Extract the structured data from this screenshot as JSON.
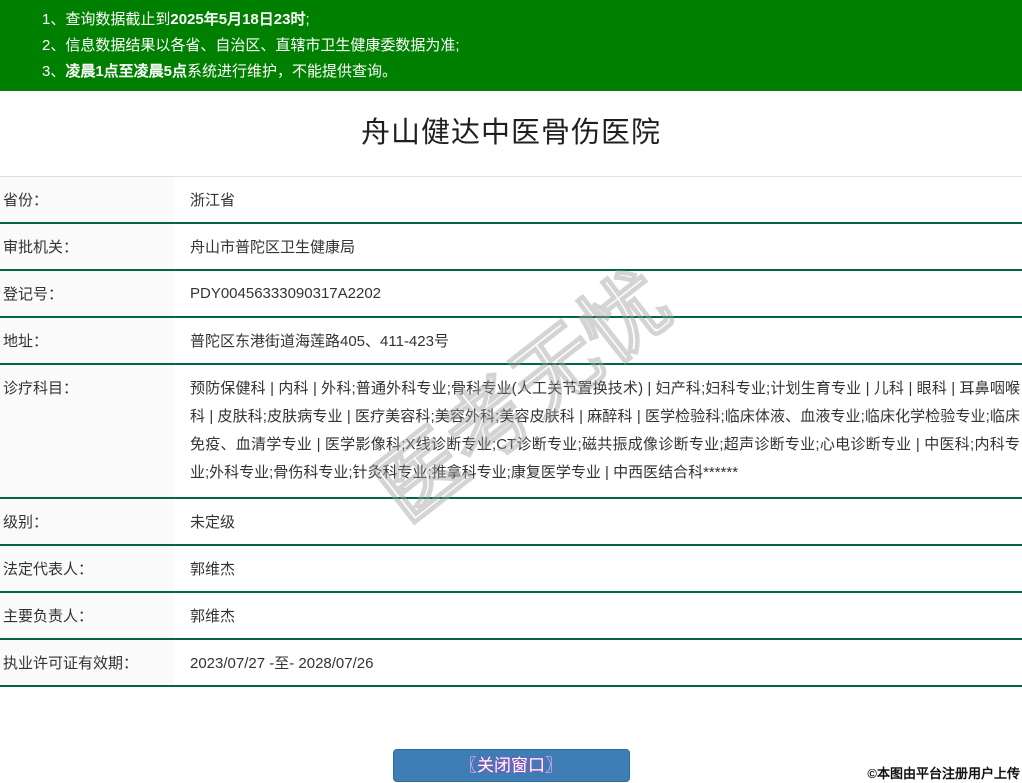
{
  "banner": {
    "bg_color": "#008000",
    "line1": {
      "num": "1、",
      "pre": "查询数据截止到",
      "bold": "2025年5月18日23时",
      "post": ";"
    },
    "line2": {
      "num": "2、",
      "pre": "信息数据结果以各省、自治区、直辖市卫生健康委数据为准;",
      "bold": "",
      "post": ""
    },
    "line3": {
      "num": "3、",
      "pre": "",
      "bold": "凌晨1点至凌晨5点",
      "post": "系统进行维护，不能提供查询。"
    }
  },
  "title": "舟山健达中医骨伤医院",
  "table": {
    "row_border_color": "#006647",
    "label_bg_color": "#fafafa",
    "rows": [
      {
        "label": "省份：",
        "value": "浙江省"
      },
      {
        "label": "审批机关：",
        "value": "舟山市普陀区卫生健康局"
      },
      {
        "label": "登记号：",
        "value": "PDY00456333090317A2202"
      },
      {
        "label": "地址：",
        "value": "普陀区东港街道海莲路405、411-423号"
      },
      {
        "label": "诊疗科目：",
        "value": "预防保健科 | 内科 | 外科;普通外科专业;骨科专业(人工关节置换技术) | 妇产科;妇科专业;计划生育专业 | 儿科 | 眼科 | 耳鼻咽喉科 | 皮肤科;皮肤病专业 | 医疗美容科;美容外科;美容皮肤科 | 麻醉科 | 医学检验科;临床体液、血液专业;临床化学检验专业;临床免疫、血清学专业 | 医学影像科;X线诊断专业;CT诊断专业;磁共振成像诊断专业;超声诊断专业;心电诊断专业 | 中医科;内科专业;外科专业;骨伤科专业;针灸科专业;推拿科专业;康复医学专业 | 中西医结合科******"
      },
      {
        "label": "级别：",
        "value": "未定级"
      },
      {
        "label": "法定代表人：",
        "value": "郭维杰"
      },
      {
        "label": "主要负责人：",
        "value": "郭维杰"
      },
      {
        "label": "执业许可证有效期：",
        "value": "2023/07/27 -至- 2028/07/26"
      }
    ]
  },
  "watermark": {
    "text": "医考无忧",
    "stroke_color": "#a0a0a0"
  },
  "close_button": {
    "label": "〖关闭窗口〗",
    "bg_color": "#3d7eb5"
  },
  "image_credit": "©本图由平台注册用户上传"
}
